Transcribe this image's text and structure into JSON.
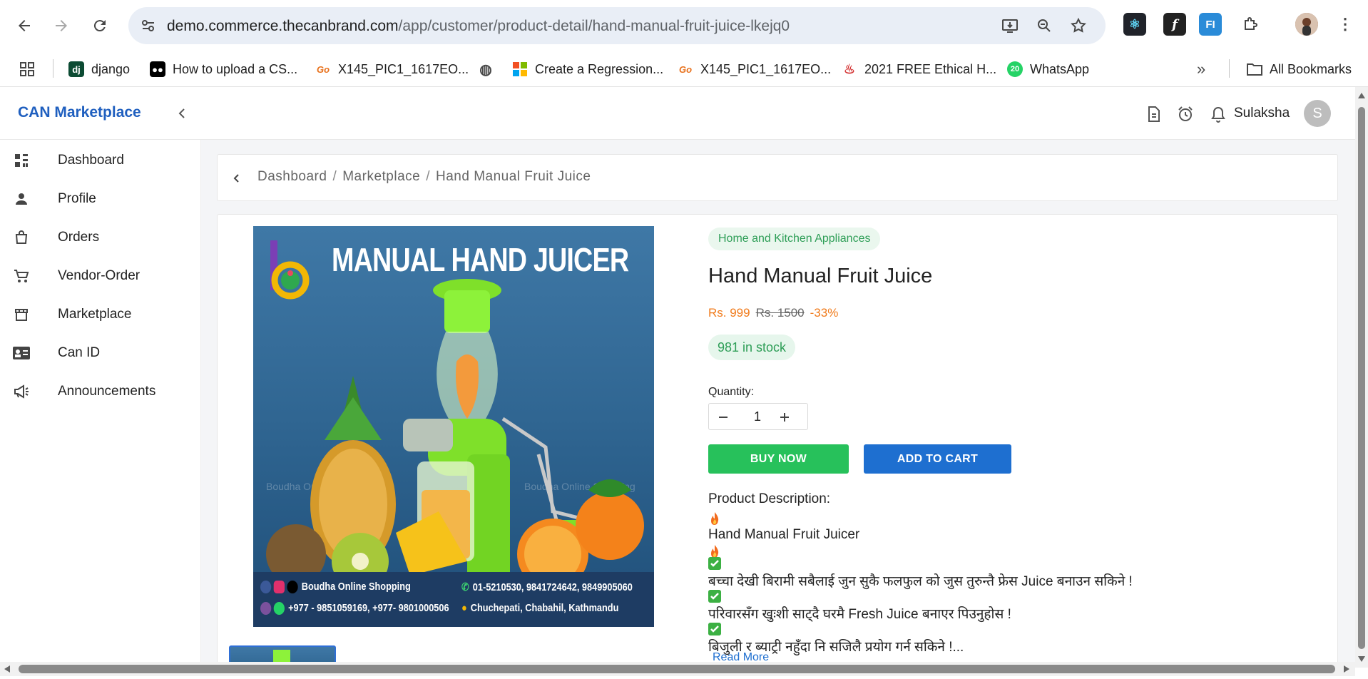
{
  "browser": {
    "url_host": "demo.commerce.thecanbrand.com",
    "url_path": "/app/customer/product-detail/hand-manual-fruit-juice-lkejq0",
    "bookmarks": [
      {
        "label": "django",
        "icon": "django-icon"
      },
      {
        "label": "How to upload a CS...",
        "icon": "medium-icon"
      },
      {
        "label": "X145_PIC1_1617EO...",
        "icon": "go-icon"
      },
      {
        "label": "",
        "icon": "globe-icon"
      },
      {
        "label": "Create a Regression...",
        "icon": "microsoft-icon"
      },
      {
        "label": "X145_PIC1_1617EO...",
        "icon": "go-icon"
      },
      {
        "label": "2021 FREE Ethical H...",
        "icon": "udemy-icon"
      },
      {
        "label": "WhatsApp",
        "icon": "whatsapp-icon"
      }
    ],
    "all_bookmarks": "All Bookmarks",
    "extensions": [
      "react-icon",
      "formula-icon",
      "fi-icon",
      "puzzle-icon"
    ]
  },
  "header": {
    "brand": "CAN Marketplace",
    "user_name": "Sulaksha",
    "avatar_initial": "S"
  },
  "sidebar": {
    "items": [
      {
        "label": "Dashboard",
        "icon": "dashboard-icon"
      },
      {
        "label": "Profile",
        "icon": "person-icon"
      },
      {
        "label": "Orders",
        "icon": "bag-icon"
      },
      {
        "label": "Vendor-Order",
        "icon": "cart-icon"
      },
      {
        "label": "Marketplace",
        "icon": "store-icon"
      },
      {
        "label": "Can ID",
        "icon": "id-card-icon"
      },
      {
        "label": "Announcements",
        "icon": "megaphone-icon"
      }
    ]
  },
  "breadcrumb": {
    "items": [
      "Dashboard",
      "Marketplace",
      "Hand Manual Fruit Juice"
    ]
  },
  "product": {
    "image": {
      "title": "MANUAL HAND JUICER",
      "footer_left_1": "Boudha Online Shopping",
      "footer_right_1": "01-5210530, 9841724642, 9849905060",
      "footer_left_2": "+977 - 9851059169, +977- 9801000506",
      "footer_right_2": "Chuchepati, Chabahil, Kathmandu",
      "watermark": "Boudha Online Shopping"
    },
    "category": "Home and Kitchen Appliances",
    "title": "Hand Manual Fruit Juice",
    "price": "Rs. 999",
    "old_price": "Rs. 1500",
    "discount": "-33%",
    "stock": "981 in stock",
    "quantity_label": "Quantity:",
    "quantity": "1",
    "buy_now": "BUY NOW",
    "add_to_cart": "ADD TO CART",
    "description_label": "Product Description:",
    "description_lines": [
      "Hand Manual Fruit Juicer",
      "बच्चा देखी बिरामी सबैलाई जुन सुकै फलफुल को जुस तुरुन्तै फ्रेस Juice बनाउन सकिने !",
      "परिवारसँग खुःशी साट्दै घरमै Fresh Juice बनाएर पिउनुहोस !",
      "बिजुली र ब्याट्री नहुँदा नि सजिलै प्रयोग गर्न सकिने !..."
    ],
    "read_more": "Read More"
  },
  "colors": {
    "brand": "#1f5fbf",
    "buy": "#27c15b",
    "cart": "#1e6fd0",
    "price": "#f07a1a",
    "stock": "#2e9e57"
  }
}
